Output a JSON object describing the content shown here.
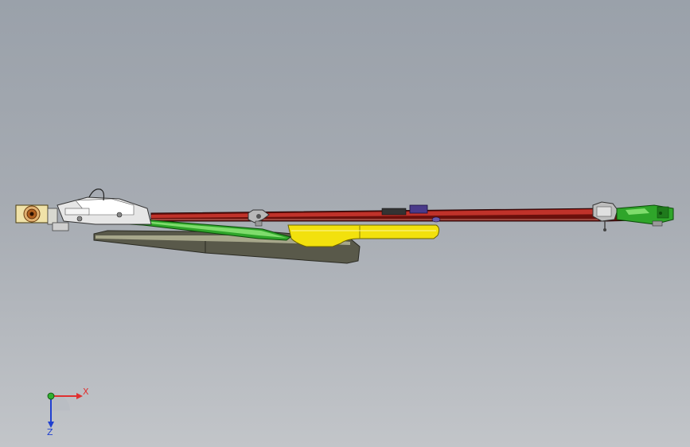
{
  "viewport": {
    "background_top": "#9aa1aa",
    "background_bottom": "#c2c5c9"
  },
  "triad": {
    "x_label": "X",
    "z_label": "Z",
    "x_color": "#e03030",
    "y_color": "#30b030",
    "z_color": "#2040d0"
  },
  "model": {
    "colors": {
      "rail": "#8a1a12",
      "guide": "#2fa52a",
      "slide": "#f2e10d",
      "base": "#5c5c4a",
      "housing": "#e6e6e6",
      "motor": "#f0e2a8"
    }
  }
}
